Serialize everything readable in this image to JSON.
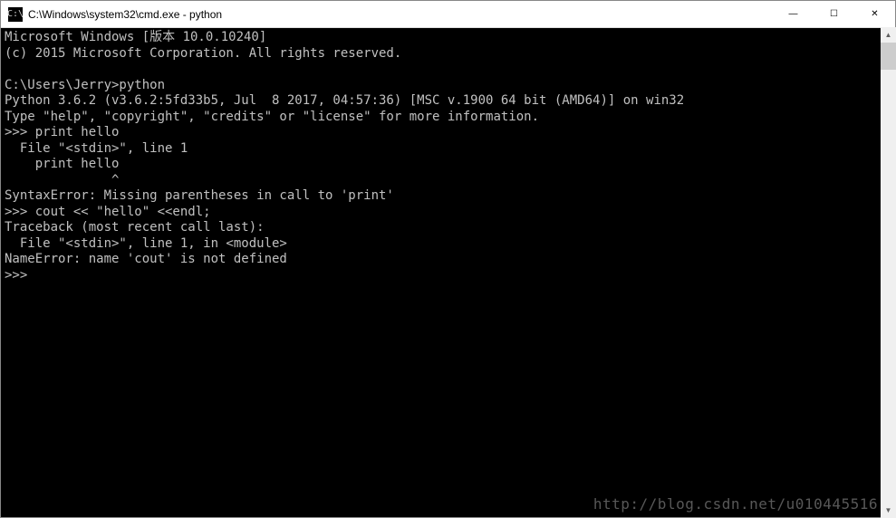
{
  "window": {
    "icon_label": "C:\\",
    "title": "C:\\Windows\\system32\\cmd.exe - python"
  },
  "controls": {
    "minimize": "—",
    "maximize": "☐",
    "close": "✕"
  },
  "terminal": {
    "lines": [
      "Microsoft Windows [版本 10.0.10240]",
      "(c) 2015 Microsoft Corporation. All rights reserved.",
      "",
      "C:\\Users\\Jerry>python",
      "Python 3.6.2 (v3.6.2:5fd33b5, Jul  8 2017, 04:57:36) [MSC v.1900 64 bit (AMD64)] on win32",
      "Type \"help\", \"copyright\", \"credits\" or \"license\" for more information.",
      ">>> print hello",
      "  File \"<stdin>\", line 1",
      "    print hello",
      "              ^",
      "SyntaxError: Missing parentheses in call to 'print'",
      ">>> cout << \"hello\" <<endl;",
      "Traceback (most recent call last):",
      "  File \"<stdin>\", line 1, in <module>",
      "NameError: name 'cout' is not defined",
      ">>>"
    ]
  },
  "watermark": "http://blog.csdn.net/u010445516"
}
